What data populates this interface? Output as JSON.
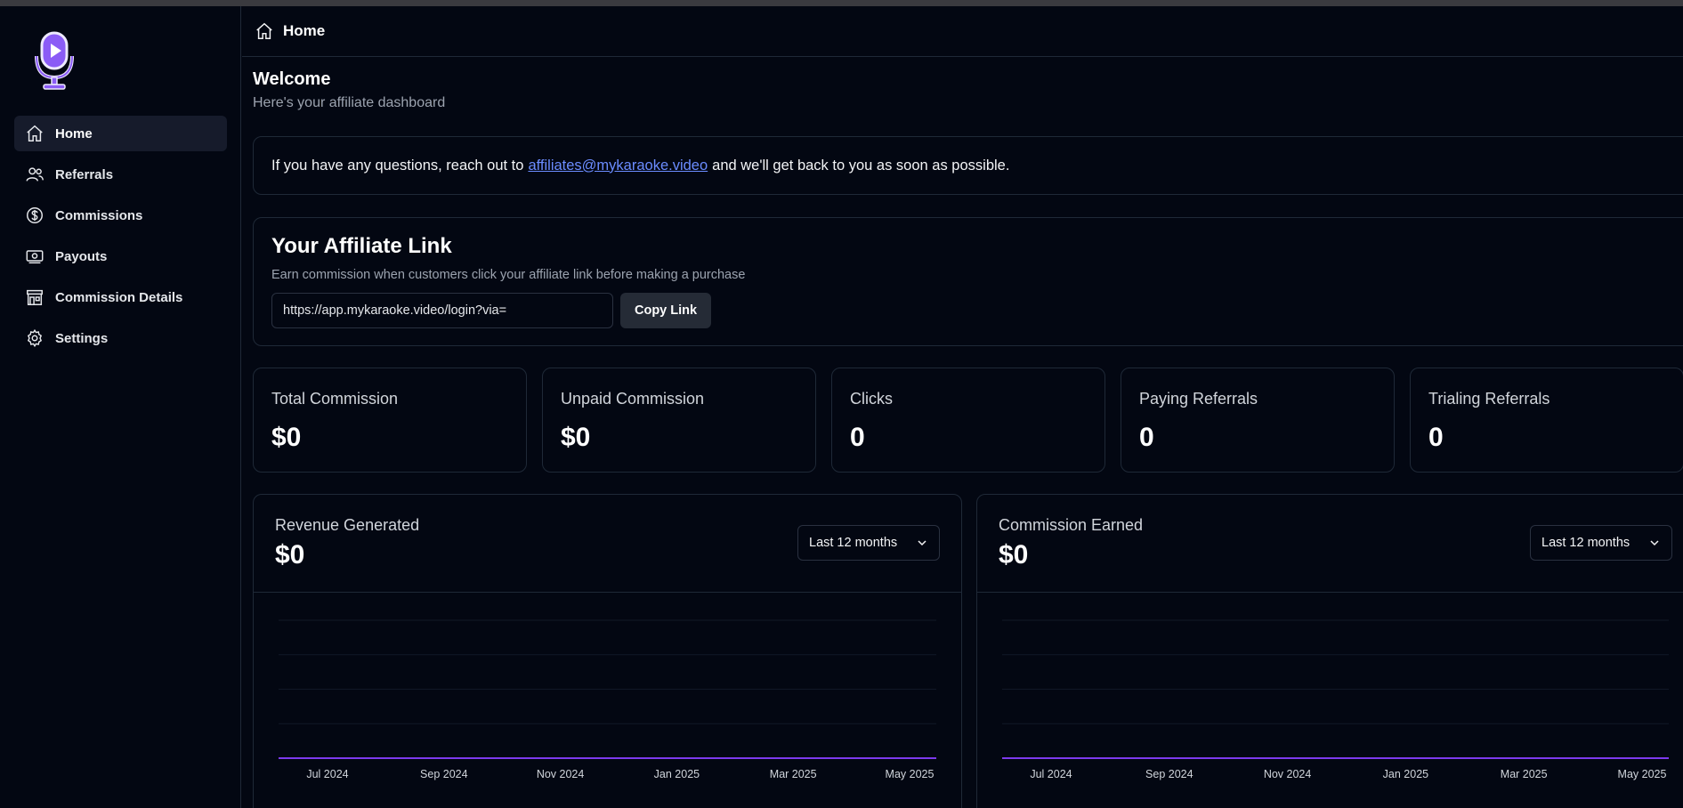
{
  "header": {
    "title": "Home"
  },
  "sidebar": {
    "items": [
      {
        "label": "Home",
        "icon": "home-icon",
        "active": true
      },
      {
        "label": "Referrals",
        "icon": "users-icon"
      },
      {
        "label": "Commissions",
        "icon": "dollar-circle-icon"
      },
      {
        "label": "Payouts",
        "icon": "banknote-icon"
      },
      {
        "label": "Commission Details",
        "icon": "store-icon"
      },
      {
        "label": "Settings",
        "icon": "gear-icon"
      }
    ]
  },
  "welcome": {
    "title": "Welcome",
    "subtitle": "Here's your affiliate dashboard"
  },
  "notice": {
    "before": "If you have any questions, reach out to",
    "email": "affiliates@mykaraoke.video",
    "after": "and we'll get back to you as soon as possible."
  },
  "affiliate": {
    "title": "Your Affiliate Link",
    "subtitle": "Earn commission when customers click your affiliate link before making a purchase",
    "link_value": "https://app.mykaraoke.video/login?via=",
    "copy_label": "Copy Link"
  },
  "stats": [
    {
      "label": "Total Commission",
      "value": "$0"
    },
    {
      "label": "Unpaid Commission",
      "value": "$0"
    },
    {
      "label": "Clicks",
      "value": "0"
    },
    {
      "label": "Paying Referrals",
      "value": "0"
    },
    {
      "label": "Trialing Referrals",
      "value": "0"
    }
  ],
  "charts": [
    {
      "label": "Revenue Generated",
      "value": "$0",
      "range": "Last 12 months"
    },
    {
      "label": "Commission Earned",
      "value": "$0",
      "range": "Last 12 months"
    }
  ],
  "colors": {
    "accent": "#7c3aed",
    "link": "#6b8cff"
  },
  "chart_data": [
    {
      "type": "line",
      "title": "Revenue Generated",
      "x": [
        "Jul 2024",
        "Sep 2024",
        "Nov 2024",
        "Jan 2025",
        "Mar 2025",
        "May 2025"
      ],
      "values": [
        0,
        0,
        0,
        0,
        0,
        0
      ],
      "grid": true
    },
    {
      "type": "line",
      "title": "Commission Earned",
      "x": [
        "Jul 2024",
        "Sep 2024",
        "Nov 2024",
        "Jan 2025",
        "Mar 2025",
        "May 2025"
      ],
      "values": [
        0,
        0,
        0,
        0,
        0,
        0
      ],
      "grid": true
    }
  ]
}
